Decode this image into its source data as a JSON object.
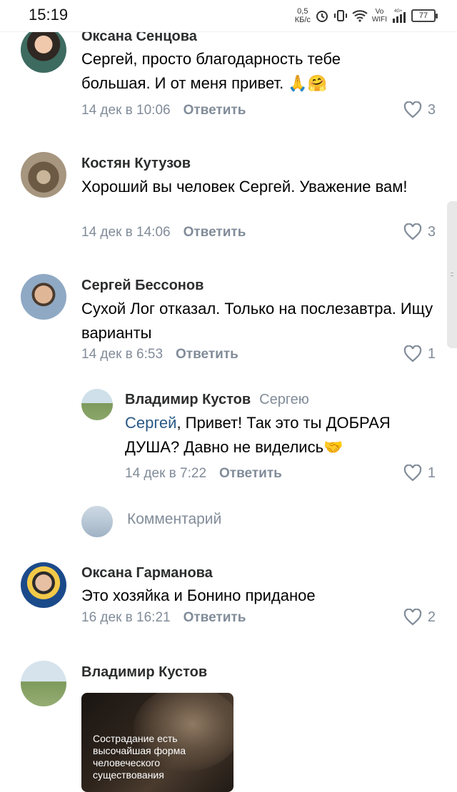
{
  "status": {
    "time": "15:19",
    "speed_value": "0,5",
    "speed_unit": "КБ/с",
    "vo_top": "Vo",
    "vo_bottom": "WIFI",
    "network": "4G+",
    "battery": "77"
  },
  "comments": [
    {
      "author": "Оксана Сенцова",
      "text": "Сергей, просто благодарность тебе большая. И от меня привет.",
      "emojis": "🙏🤗",
      "date": "14 дек в 10:06",
      "reply_label": "Ответить",
      "likes": "3"
    },
    {
      "author": "Костян Кутузов",
      "text": "Хороший вы человек Сергей. Уважение вам!",
      "date": "14 дек в 14:06",
      "reply_label": "Ответить",
      "likes": "3"
    },
    {
      "author": "Сергей Бессонов",
      "text": "Сухой Лог отказал. Только на послезавтра. Ищу варианты",
      "date": "14 дек в 6:53",
      "reply_label": "Ответить",
      "likes": "1"
    },
    {
      "author": "Оксана Гарманова",
      "text": "Это хозяйка и Бонино приданое",
      "date": "16 дек в 16:21",
      "reply_label": "Ответить",
      "likes": "2"
    },
    {
      "author": "Владимир Кустов",
      "image_caption": "Сострадание есть высочайшая форма человеческого существования"
    }
  ],
  "reply": {
    "author": "Владимир Кустов",
    "reply_to": "Сергею",
    "mention": "Сергей",
    "text": ", Привет! Так это ты ДОБРАЯ ДУША? Давно не виделись",
    "emoji": "🤝",
    "date": "14 дек в 7:22",
    "reply_label": "Ответить",
    "likes": "1"
  },
  "comment_input": {
    "placeholder": "Комментарий"
  },
  "colors": {
    "accent": "#2a5885",
    "secondary_text": "#818c99"
  }
}
